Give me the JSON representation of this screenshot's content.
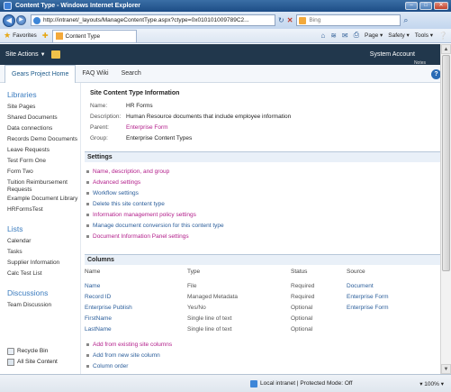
{
  "window": {
    "title": "Content Type - Windows Internet Explorer",
    "minimize": "–",
    "maximize": "□",
    "close": "✕"
  },
  "address_bar": {
    "back": "◀",
    "forward": "▶",
    "url": "http://intranet/_layouts/ManageContentType.aspx?ctype=0x010101009789C2...",
    "refresh": "↻",
    "stop": "✕",
    "search_placeholder": "Bing",
    "search_go": "⌕"
  },
  "favorites_bar": {
    "favorites_label": "Favorites",
    "tab_label": "Content Type",
    "commands": [
      "Page ▾",
      "Safety ▾",
      "Tools ▾"
    ]
  },
  "sharepoint": {
    "site_actions": "Site Actions",
    "account": "System Account",
    "tags": "Notes"
  },
  "top_nav": {
    "items": [
      "Gears Project Home",
      "FAQ Wiki",
      "Search"
    ],
    "help": "?"
  },
  "quick_launch": {
    "libraries_heading": "Libraries",
    "libraries": [
      "Site Pages",
      "Shared Documents",
      "Data connections",
      "Records Demo Documents",
      "Leave Requests",
      "Test Form One",
      "Form Two",
      "Tuition Reimbursement Requests",
      "Example Document Library",
      "HRFormsTest"
    ],
    "lists_heading": "Lists",
    "lists": [
      "Calendar",
      "Tasks",
      "Supplier Information",
      "Calc Test List"
    ],
    "discussions_heading": "Discussions",
    "discussions": [
      "Team Discussion"
    ],
    "recycle_bin": "Recycle Bin",
    "all_site_content": "All Site Content"
  },
  "info": {
    "title": "Site Content Type Information",
    "rows": [
      {
        "label": "Name:",
        "value": "HR Forms"
      },
      {
        "label": "Description:",
        "value": "Human Resource documents that include employee information"
      },
      {
        "label": "Parent:",
        "value": "Enterprise Form"
      },
      {
        "label": "Group:",
        "value": "Enterprise Content Types"
      }
    ]
  },
  "settings": {
    "heading": "Settings",
    "links": [
      "Name, description, and group",
      "Advanced settings",
      "Workflow settings",
      "Delete this site content type",
      "Information management policy settings",
      "Manage document conversion for this content type",
      "Document Information Panel settings"
    ]
  },
  "columns": {
    "heading": "Columns",
    "headers": [
      "Name",
      "Type",
      "Status",
      "Source"
    ],
    "rows": [
      {
        "name": "Name",
        "type": "File",
        "status": "Required",
        "source": "Document"
      },
      {
        "name": "Record ID",
        "type": "Managed Metadata",
        "status": "Required",
        "source": "Enterprise Form"
      },
      {
        "name": "Enterprise Publish",
        "type": "Yes/No",
        "status": "Optional",
        "source": "Enterprise Form"
      },
      {
        "name": "FirstName",
        "type": "Single line of text",
        "status": "Optional",
        "source": ""
      },
      {
        "name": "LastName",
        "type": "Single line of text",
        "status": "Optional",
        "source": ""
      }
    ],
    "actions": [
      "Add from existing site columns",
      "Add from new site column",
      "Column order"
    ]
  },
  "status_bar": {
    "zone": "Local intranet | Protected Mode: Off",
    "zoom": "▾ 100% ▾"
  }
}
